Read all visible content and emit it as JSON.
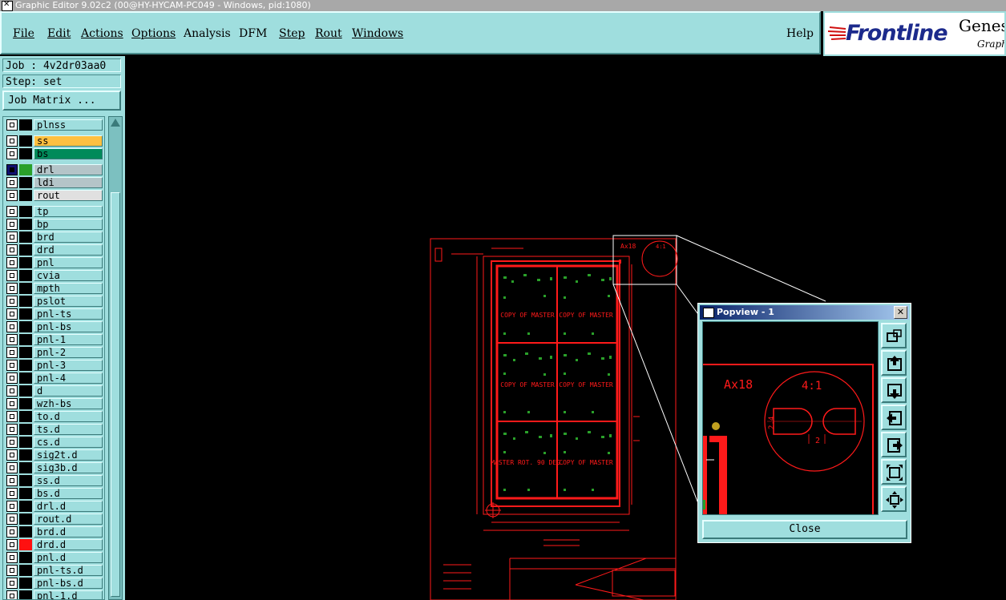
{
  "window": {
    "title": "Graphic Editor 9.02c2 (00@HY-HYCAM-PC049 - Windows, pid:1080)"
  },
  "menu": {
    "items": [
      "File",
      "Edit",
      "Actions",
      "Options",
      "Analysis",
      "DFM",
      "Step",
      "Rout",
      "Windows"
    ],
    "help": "Help"
  },
  "brand": {
    "logo": "Frontline",
    "product": "Genes",
    "sub": "Graph"
  },
  "job": {
    "label": "Job : 4v2dr03aa0",
    "step": "Step: set",
    "matrix_button": "Job Matrix ..."
  },
  "layers": [
    {
      "name": "plnss",
      "checked": false,
      "color": "#000000",
      "fill": "#9fdede"
    },
    {
      "name": "ss",
      "checked": false,
      "color": "#000000",
      "fill": "#ffc040"
    },
    {
      "name": "bs",
      "checked": false,
      "color": "#000000",
      "fill": "#008a5a"
    },
    {
      "name": "drl",
      "checked": true,
      "color": "#2aa02a",
      "fill": "#b4c4c8",
      "box": "#101070"
    },
    {
      "name": "ldi",
      "checked": false,
      "color": "#000000",
      "fill": "#b4c4c8"
    },
    {
      "name": "rout",
      "checked": false,
      "color": "#000000",
      "fill": "#e0e0e0"
    },
    {
      "name": "tp",
      "checked": false,
      "color": "#000000",
      "fill": "#9fdede"
    },
    {
      "name": "bp",
      "checked": false,
      "color": "#000000",
      "fill": "#9fdede"
    },
    {
      "name": "brd",
      "checked": false,
      "color": "#000000",
      "fill": "#9fdede"
    },
    {
      "name": "drd",
      "checked": false,
      "color": "#000000",
      "fill": "#9fdede"
    },
    {
      "name": "pnl",
      "checked": false,
      "color": "#000000",
      "fill": "#9fdede"
    },
    {
      "name": "cvia",
      "checked": false,
      "color": "#000000",
      "fill": "#9fdede"
    },
    {
      "name": "mpth",
      "checked": false,
      "color": "#000000",
      "fill": "#9fdede"
    },
    {
      "name": "pslot",
      "checked": false,
      "color": "#000000",
      "fill": "#9fdede"
    },
    {
      "name": "pnl-ts",
      "checked": false,
      "color": "#000000",
      "fill": "#9fdede"
    },
    {
      "name": "pnl-bs",
      "checked": false,
      "color": "#000000",
      "fill": "#9fdede"
    },
    {
      "name": "pnl-1",
      "checked": false,
      "color": "#000000",
      "fill": "#9fdede"
    },
    {
      "name": "pnl-2",
      "checked": false,
      "color": "#000000",
      "fill": "#9fdede"
    },
    {
      "name": "pnl-3",
      "checked": false,
      "color": "#000000",
      "fill": "#9fdede"
    },
    {
      "name": "pnl-4",
      "checked": false,
      "color": "#000000",
      "fill": "#9fdede"
    },
    {
      "name": "d",
      "checked": false,
      "color": "#000000",
      "fill": "#9fdede"
    },
    {
      "name": "wzh-bs",
      "checked": false,
      "color": "#000000",
      "fill": "#9fdede"
    },
    {
      "name": "to.d",
      "checked": false,
      "color": "#000000",
      "fill": "#9fdede"
    },
    {
      "name": "ts.d",
      "checked": false,
      "color": "#000000",
      "fill": "#9fdede"
    },
    {
      "name": "cs.d",
      "checked": false,
      "color": "#000000",
      "fill": "#9fdede"
    },
    {
      "name": "sig2t.d",
      "checked": false,
      "color": "#000000",
      "fill": "#9fdede"
    },
    {
      "name": "sig3b.d",
      "checked": false,
      "color": "#000000",
      "fill": "#9fdede"
    },
    {
      "name": "ss.d",
      "checked": false,
      "color": "#000000",
      "fill": "#9fdede"
    },
    {
      "name": "bs.d",
      "checked": false,
      "color": "#000000",
      "fill": "#9fdede"
    },
    {
      "name": "drl.d",
      "checked": false,
      "color": "#000000",
      "fill": "#9fdede"
    },
    {
      "name": "rout.d",
      "checked": false,
      "color": "#000000",
      "fill": "#9fdede"
    },
    {
      "name": "brd.d",
      "checked": false,
      "color": "#000000",
      "fill": "#9fdede"
    },
    {
      "name": "drd.d",
      "checked": false,
      "color": "#ff1010",
      "fill": "#9fdede"
    },
    {
      "name": "pnl.d",
      "checked": false,
      "color": "#000000",
      "fill": "#9fdede"
    },
    {
      "name": "pnl-ts.d",
      "checked": false,
      "color": "#000000",
      "fill": "#9fdede"
    },
    {
      "name": "pnl-bs.d",
      "checked": false,
      "color": "#000000",
      "fill": "#9fdede"
    },
    {
      "name": "pnl-1.d",
      "checked": false,
      "color": "#000000",
      "fill": "#9fdede"
    }
  ],
  "canvas": {
    "cell_texts": [
      "COPY OF MASTER",
      "COPY OF MASTER",
      "COPY OF MASTER",
      "COPY OF MASTER",
      "MASTER ROT. 90 DEG.",
      "COPY OF MASTER"
    ],
    "zoom_label": "Ax18",
    "zoom_scale": "4:1"
  },
  "popview": {
    "title": "Popview - 1",
    "close_label": "Close",
    "detail_label": "Ax18",
    "detail_scale": "4:1",
    "dim_a": "2.4",
    "dim_b": "2",
    "buttons": [
      "zoom-home-icon",
      "pan-up-icon",
      "pan-down-icon",
      "pan-left-icon",
      "pan-right-icon",
      "zoom-in-icon",
      "zoom-out-icon"
    ]
  },
  "colors": {
    "panel": "#9fdede",
    "drawing": "#ff1a1a",
    "pads": "#2aa02a"
  }
}
